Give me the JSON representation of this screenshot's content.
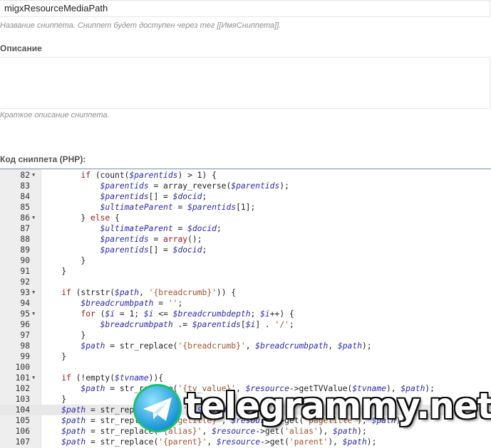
{
  "form": {
    "snippet_name": "migxResourceMediaPath",
    "name_hint": "Название сниппета. Сниппет будет доступен через тег [[ИмяСниппета]].",
    "description_label": "Описание",
    "description_value": "",
    "description_hint": "Краткое описание сниппета.",
    "code_label": "Код сниппета (PHP):"
  },
  "editor": {
    "active_line": 104,
    "lines": [
      {
        "n": "82",
        "fold": true,
        "html": "        <span class=\"k\">if</span> (count(<span class=\"v\">$parentids</span>) &gt; 1) {"
      },
      {
        "n": "83",
        "fold": false,
        "html": "            <span class=\"v\">$parentids</span> = array_reverse(<span class=\"v\">$parentids</span>);"
      },
      {
        "n": "84",
        "fold": false,
        "html": "            <span class=\"v\">$parentids</span>[] = <span class=\"v\">$docid</span>;"
      },
      {
        "n": "85",
        "fold": false,
        "html": "            <span class=\"v\">$ultimateParent</span> = <span class=\"v\">$parentids</span>[1];"
      },
      {
        "n": "86",
        "fold": true,
        "html": "        } <span class=\"k\">else</span> {"
      },
      {
        "n": "87",
        "fold": false,
        "html": "            <span class=\"v\">$ultimateParent</span> = <span class=\"v\">$docid</span>;"
      },
      {
        "n": "88",
        "fold": false,
        "html": "            <span class=\"v\">$parentids</span> = <span class=\"k\">array</span>();"
      },
      {
        "n": "89",
        "fold": false,
        "html": "            <span class=\"v\">$parentids</span>[] = <span class=\"v\">$docid</span>;"
      },
      {
        "n": "90",
        "fold": false,
        "html": "        }"
      },
      {
        "n": "91",
        "fold": false,
        "html": "    }"
      },
      {
        "n": "92",
        "fold": false,
        "html": ""
      },
      {
        "n": "93",
        "fold": true,
        "html": "    <span class=\"k\">if</span> (strstr(<span class=\"v\">$path</span>, <span class=\"s\">'{breadcrumb}'</span>)) {"
      },
      {
        "n": "94",
        "fold": false,
        "html": "        <span class=\"v\">$breadcrumbpath</span> = <span class=\"s\">''</span>;"
      },
      {
        "n": "95",
        "fold": true,
        "html": "        <span class=\"k\">for</span> (<span class=\"v\">$i</span> = 1; <span class=\"v\">$i</span> &lt;= <span class=\"v\">$breadcrumbdepth</span>; <span class=\"v\">$i</span>++) {"
      },
      {
        "n": "96",
        "fold": false,
        "html": "            <span class=\"v\">$breadcrumbpath</span> .= <span class=\"v\">$parentids</span>[<span class=\"v\">$i</span>] . <span class=\"s\">'/'</span>;"
      },
      {
        "n": "97",
        "fold": false,
        "html": "        }"
      },
      {
        "n": "98",
        "fold": false,
        "html": "        <span class=\"v\">$path</span> = str_replace(<span class=\"s\">'{breadcrumb}'</span>, <span class=\"v\">$breadcrumbpath</span>, <span class=\"v\">$path</span>);"
      },
      {
        "n": "99",
        "fold": false,
        "html": "    }"
      },
      {
        "n": "100",
        "fold": false,
        "html": ""
      },
      {
        "n": "101",
        "fold": true,
        "html": "    <span class=\"k\">if</span> (!empty(<span class=\"v\">$tvname</span>)){"
      },
      {
        "n": "102",
        "fold": false,
        "html": "        <span class=\"v\">$path</span> = str_replace(<span class=\"s\">'{tv_value}'</span>, <span class=\"v\">$resource</span>-&gt;getTVValue(<span class=\"v\">$tvname</span>), <span class=\"v\">$path</span>);"
      },
      {
        "n": "103",
        "fold": false,
        "html": "    }"
      },
      {
        "n": "104",
        "fold": false,
        "html": "    <span class=\"v\">$path</span> = str_replace(<span class=\"s\">'{id}'</span>, <span class=\"v\">$docid</span>, <span class=\"v\">$path</span>);"
      },
      {
        "n": "105",
        "fold": false,
        "html": "    <span class=\"v\">$path</span> = str_replace(<span class=\"s\">'{pagetitle}'</span>, <span class=\"v\">$resource</span>-&gt;get(<span class=\"s\">'pagetitle'</span>), <span class=\"v\">$path</span>);"
      },
      {
        "n": "106",
        "fold": false,
        "html": "    <span class=\"v\">$path</span> = str_replace(<span class=\"s\">'{alias}'</span>, <span class=\"v\">$resource</span>-&gt;get(<span class=\"s\">'alias'</span>), <span class=\"v\">$path</span>);"
      },
      {
        "n": "107",
        "fold": false,
        "html": "    <span class=\"v\">$path</span> = str_replace(<span class=\"s\">'{parent}'</span>, <span class=\"v\">$resource</span>-&gt;get(<span class=\"s\">'parent'</span>), <span class=\"v\">$path</span>);"
      }
    ]
  },
  "watermark": {
    "text": "telegrammy.net",
    "logo_icon": "telegram-paper-plane-icon"
  }
}
